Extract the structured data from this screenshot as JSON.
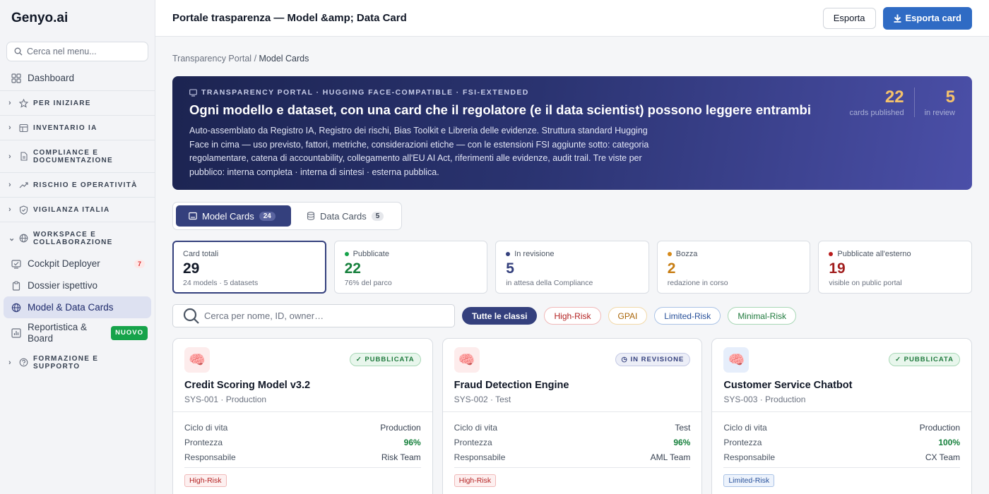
{
  "brand": "Genyo.ai",
  "sidebar": {
    "search_placeholder": "Cerca nel menu...",
    "items": {
      "dashboard": "Dashboard",
      "per_iniziare": "PER INIZIARE",
      "inventario": "INVENTARIO IA",
      "compliance_1": "COMPLIANCE E",
      "compliance_2": "DOCUMENTAZIONE",
      "rischio": "RISCHIO E OPERATIVITÀ",
      "vigilanza": "VIGILANZA ITALIA",
      "workspace_1": "WORKSPACE E",
      "workspace_2": "COLLABORAZIONE",
      "cockpit": "Cockpit Deployer",
      "cockpit_badge": "7",
      "dossier": "Dossier ispettivo",
      "model_cards": "Model & Data Cards",
      "report_1": "Reportistica &",
      "report_2": "Board",
      "report_badge": "NUOVO",
      "formazione_1": "FORMAZIONE E",
      "formazione_2": "SUPPORTO"
    }
  },
  "topbar": {
    "title": "Portale trasparenza — Model &amp; Data Card",
    "export": "Esporta",
    "export_card": "Esporta card"
  },
  "breadcrumb": {
    "root": "Transparency Portal",
    "sep": " / ",
    "current": "Model Cards"
  },
  "hero": {
    "kicker": "TRANSPARENCY PORTAL · HUGGING FACE-COMPATIBLE · FSI-EXTENDED",
    "title": "Ogni modello e dataset, con una card che il regolatore (e il data scientist) possono leggere entrambi",
    "text": "Auto-assemblato da Registro IA, Registro dei rischi, Bias Toolkit e Libreria delle evidenze. Struttura standard Hugging Face in cima — uso previsto, fattori, metriche, considerazioni etiche — con le estensioni FSI aggiunte sotto: categoria regolamentare, catena di accountability, collegamento all'EU AI Act, riferimenti alle evidenze, audit trail. Tre viste per pubblico: interna completa · interna di sintesi · esterna pubblica.",
    "stats": [
      {
        "value": "22",
        "label": "cards published"
      },
      {
        "value": "5",
        "label": "in review"
      }
    ]
  },
  "tabs": [
    {
      "label": "Model Cards",
      "count": "24"
    },
    {
      "label": "Data Cards",
      "count": "5"
    }
  ],
  "kpis": [
    {
      "label": "Card totali",
      "value": "29",
      "sub": "24 models · 5 datasets",
      "color": "#111827",
      "dot": ""
    },
    {
      "label": "Pubblicate",
      "value": "22",
      "sub": "76% del parco",
      "color": "#16803c",
      "dot": "#16a34a"
    },
    {
      "label": "In revisione",
      "value": "5",
      "sub": "in attesa della Compliance",
      "color": "#34407d",
      "dot": "#34407d"
    },
    {
      "label": "Bozza",
      "value": "2",
      "sub": "redazione in corso",
      "color": "#c77d12",
      "dot": "#d68a1a"
    },
    {
      "label": "Pubblicate all'esterno",
      "value": "19",
      "sub": "visible on public portal",
      "color": "#a11d1d",
      "dot": "#b91c1c"
    }
  ],
  "filters": {
    "search_placeholder": "Cerca per nome, ID, owner…",
    "chips": [
      "Tutte le classi",
      "High-Risk",
      "GPAI",
      "Limited-Risk",
      "Minimal-Risk"
    ]
  },
  "cards": [
    {
      "title": "Credit Scoring Model v3.2",
      "sub": "SYS-001 · Production",
      "status": "✓ PUBBLICATA",
      "rows": [
        {
          "k": "Ciclo di vita",
          "v": "Production"
        },
        {
          "k": "Prontezza",
          "v": "96%"
        },
        {
          "k": "Responsabile",
          "v": "Risk Team"
        }
      ],
      "risk": "High-Risk"
    },
    {
      "title": "Fraud Detection Engine",
      "sub": "SYS-002 · Test",
      "status": "◷ IN REVISIONE",
      "rows": [
        {
          "k": "Ciclo di vita",
          "v": "Test"
        },
        {
          "k": "Prontezza",
          "v": "96%"
        },
        {
          "k": "Responsabile",
          "v": "AML Team"
        }
      ],
      "risk": "High-Risk"
    },
    {
      "title": "Customer Service Chatbot",
      "sub": "SYS-003 · Production",
      "status": "✓ PUBBLICATA",
      "rows": [
        {
          "k": "Ciclo di vita",
          "v": "Production"
        },
        {
          "k": "Prontezza",
          "v": "100%"
        },
        {
          "k": "Responsabile",
          "v": "CX Team"
        }
      ],
      "risk": "Limited-Risk"
    }
  ],
  "icons": {
    "search": "search-icon",
    "brain": "brain-icon",
    "download": "download-icon"
  }
}
